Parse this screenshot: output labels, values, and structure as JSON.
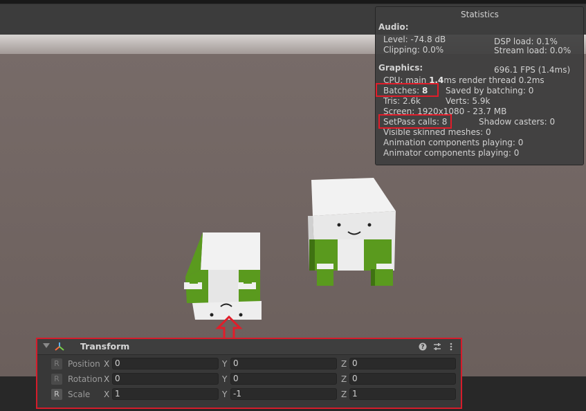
{
  "stats": {
    "title": "Statistics",
    "audio": {
      "heading": "Audio:",
      "level": "Level: -74.8 dB",
      "dsp_load": "DSP load: 0.1%",
      "clipping": "Clipping: 0.0%",
      "stream_load": "Stream load: 0.0%"
    },
    "graphics": {
      "heading": "Graphics:",
      "fps": "696.1 FPS (1.4ms)",
      "cpu_prefix": "CPU: main ",
      "cpu_main": "1.4",
      "cpu_suffix": "ms  render thread 0.2ms",
      "batches_label": "Batches: ",
      "batches_value": "8",
      "saved_by_batching": "Saved by batching: 0",
      "tris": "Tris: 2.6k",
      "verts": "Verts: 5.9k",
      "screen": "Screen: 1920x1080 - 23.7 MB",
      "setpass": "SetPass calls: 8",
      "shadow_casters": "Shadow casters: 0",
      "skinned": "Visible skinned meshes: 0",
      "animation": "Animation components playing: 0",
      "animator": "Animator components playing: 0"
    }
  },
  "inspector": {
    "title": "Transform",
    "rows": [
      {
        "label": "Position",
        "reset": "R",
        "x": "0",
        "y": "0",
        "z": "0"
      },
      {
        "label": "Rotation",
        "reset": "R",
        "x": "0",
        "y": "0",
        "z": "0"
      },
      {
        "label": "Scale",
        "reset": "R",
        "x": "1",
        "y": "-1",
        "z": "1"
      }
    ],
    "axes": {
      "x": "X",
      "y": "Y",
      "z": "Z"
    },
    "icons": {
      "component": "transform-axes-icon",
      "help": "help-icon",
      "presets": "presets-sliders-icon",
      "menu": "kebab-menu-icon"
    }
  },
  "colors": {
    "highlight": "#e11d2a",
    "ground": "#6b5f5c",
    "character_white": "#ececec",
    "character_green": "#5a9a1e"
  }
}
